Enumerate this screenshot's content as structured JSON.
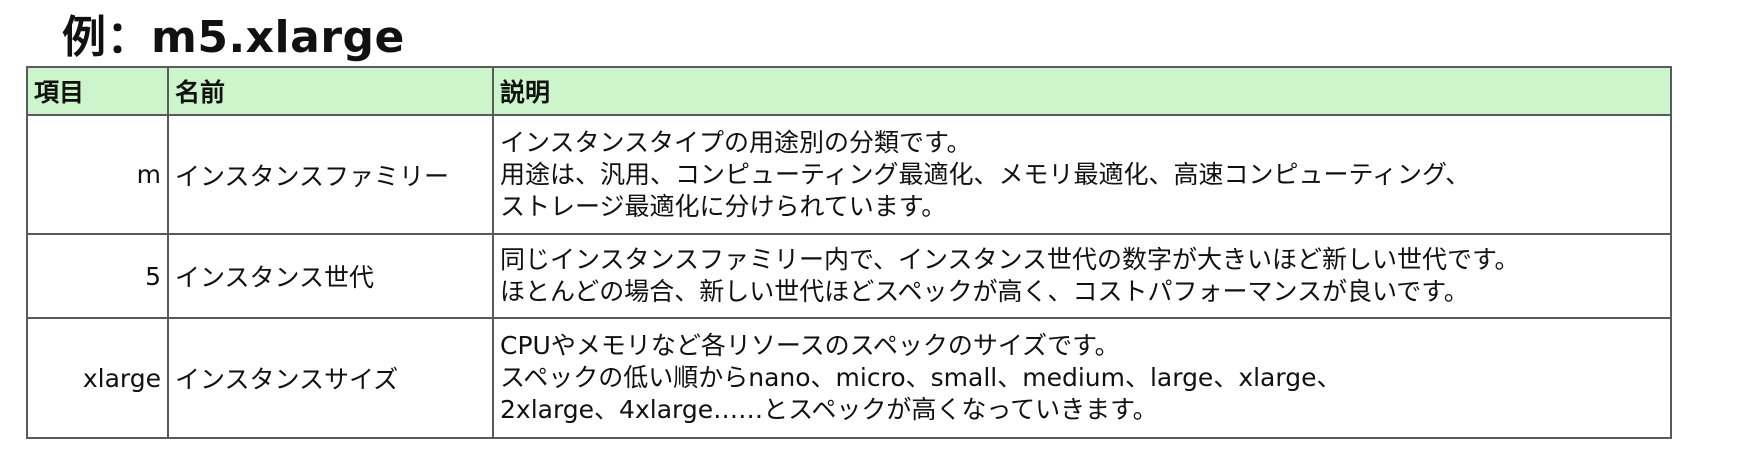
{
  "title": "例：m5.xlarge",
  "table": {
    "headers": [
      "項目",
      "名前",
      "説明"
    ],
    "rows": [
      {
        "item": "m",
        "name": "インスタンスファミリー",
        "desc": [
          "インスタンスタイプの用途別の分類です。",
          "用途は、汎用、コンピューティング最適化、メモリ最適化、高速コンピューティング、",
          "ストレージ最適化に分けられています。"
        ]
      },
      {
        "item": "5",
        "name": "インスタンス世代",
        "desc": [
          "同じインスタンスファミリー内で、インスタンス世代の数字が大きいほど新しい世代です。",
          "ほとんどの場合、新しい世代ほどスペックが高く、コストパフォーマンスが良いです。"
        ]
      },
      {
        "item": "xlarge",
        "name": "インスタンスサイズ",
        "desc": [
          "CPUやメモリなど各リソースのスペックのサイズです。",
          "スペックの低い順からnano、micro、small、medium、large、xlarge、",
          "2xlarge、4xlarge……とスペックが高くなっていきます。"
        ]
      }
    ]
  },
  "colors": {
    "header_bg": "#ccf5cc",
    "border": "#5a5a5a",
    "text": "#111111"
  }
}
